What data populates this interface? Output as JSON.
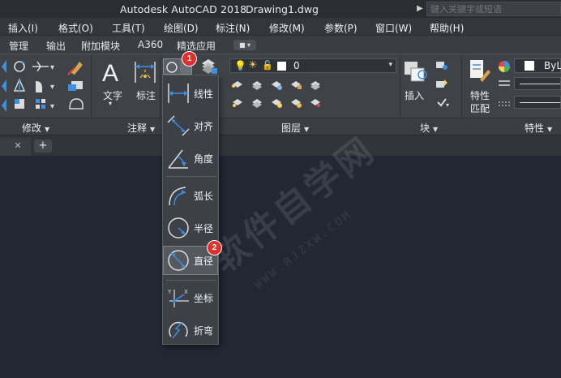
{
  "titlebar": {
    "app_title": "Autodesk AutoCAD 2018",
    "file_name": "Drawing1.dwg",
    "search_placeholder": "键入关键字或短语"
  },
  "menu": {
    "items": [
      "插入(I)",
      "格式(O)",
      "工具(T)",
      "绘图(D)",
      "标注(N)",
      "修改(M)",
      "参数(P)",
      "窗口(W)",
      "帮助(H)"
    ]
  },
  "ribbon_tabs": {
    "items": [
      "管理",
      "输出",
      "附加模块",
      "A360",
      "精选应用"
    ]
  },
  "ribbon": {
    "text_label": "文字",
    "dim_label": "标注",
    "layer_value": "0",
    "insert_label": "插入",
    "properties_label_1": "特性",
    "properties_label_2": "匹配",
    "bylayer_value": "ByL",
    "footer": {
      "modify": "修改",
      "annotation": "注释",
      "layers": "图层",
      "block": "块",
      "properties": "特性"
    }
  },
  "dimension_dropdown": {
    "items": [
      "线性",
      "对齐",
      "角度",
      "弧长",
      "半径",
      "直径",
      "坐标",
      "折弯"
    ],
    "selected": "直径"
  },
  "badges": [
    "1",
    "2"
  ],
  "watermark": {
    "text": "软件自学网",
    "url": "WWW.RJZXW.COM"
  },
  "colors": {
    "badge": "#e0302d",
    "canvas": "#222733",
    "accent_blue": "#3d8fe0"
  }
}
